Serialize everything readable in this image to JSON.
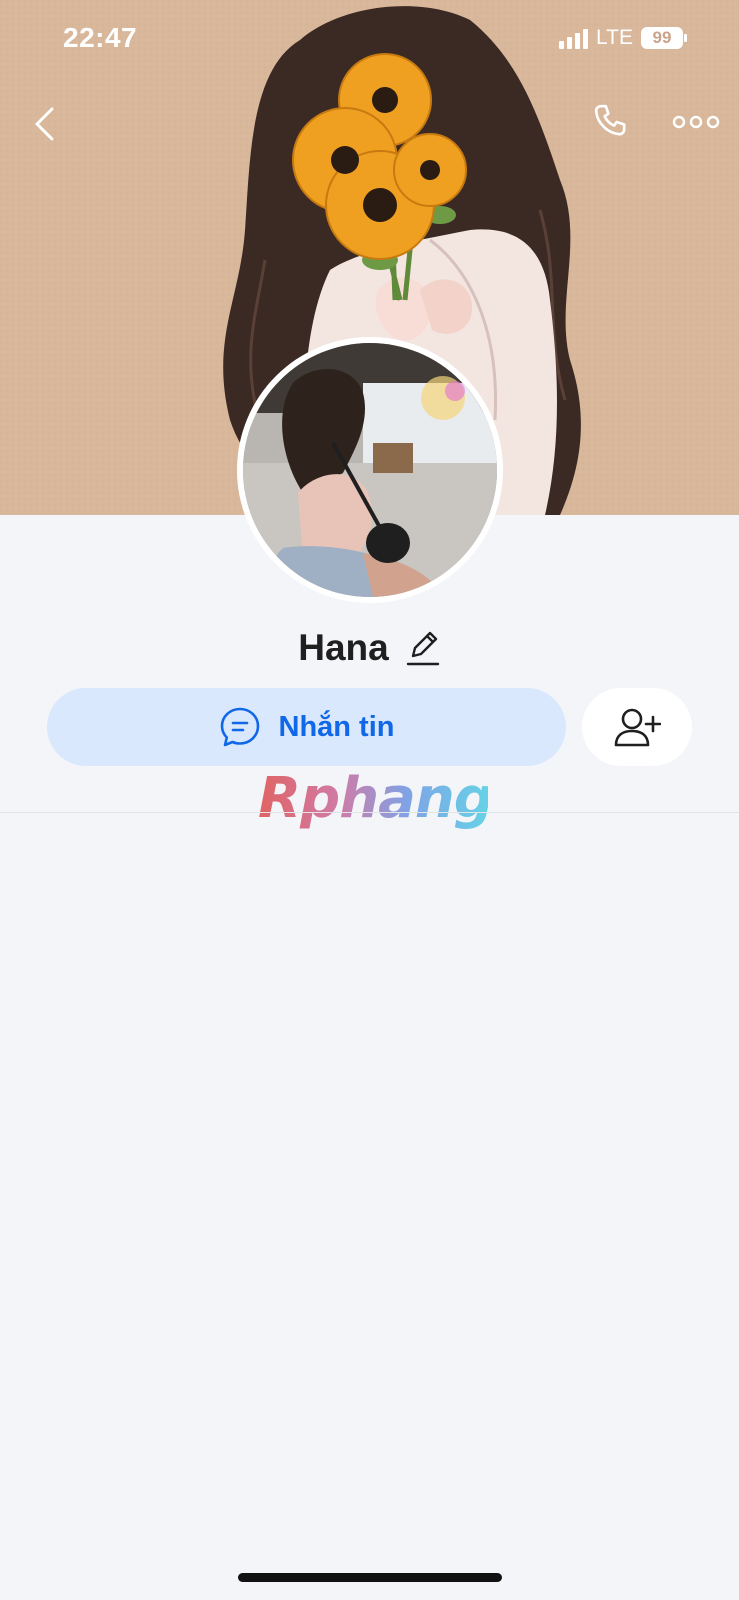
{
  "status_bar": {
    "time": "22:47",
    "network": "LTE",
    "battery": "99"
  },
  "header": {
    "back_icon": "chevron-left-icon",
    "call_icon": "phone-icon",
    "more_icon": "more-horizontal-icon"
  },
  "profile": {
    "name": "Hana",
    "edit_icon": "pencil-icon"
  },
  "actions": {
    "message_label": "Nhắn tin",
    "message_icon": "chat-bubble-icon",
    "add_friend_icon": "add-user-icon"
  },
  "watermark": "Rphang",
  "colors": {
    "accent": "#1068e8",
    "message_button_bg": "#d9e8fd",
    "page_bg": "#f3f5f8",
    "cover_bg": "#d8b79b"
  }
}
